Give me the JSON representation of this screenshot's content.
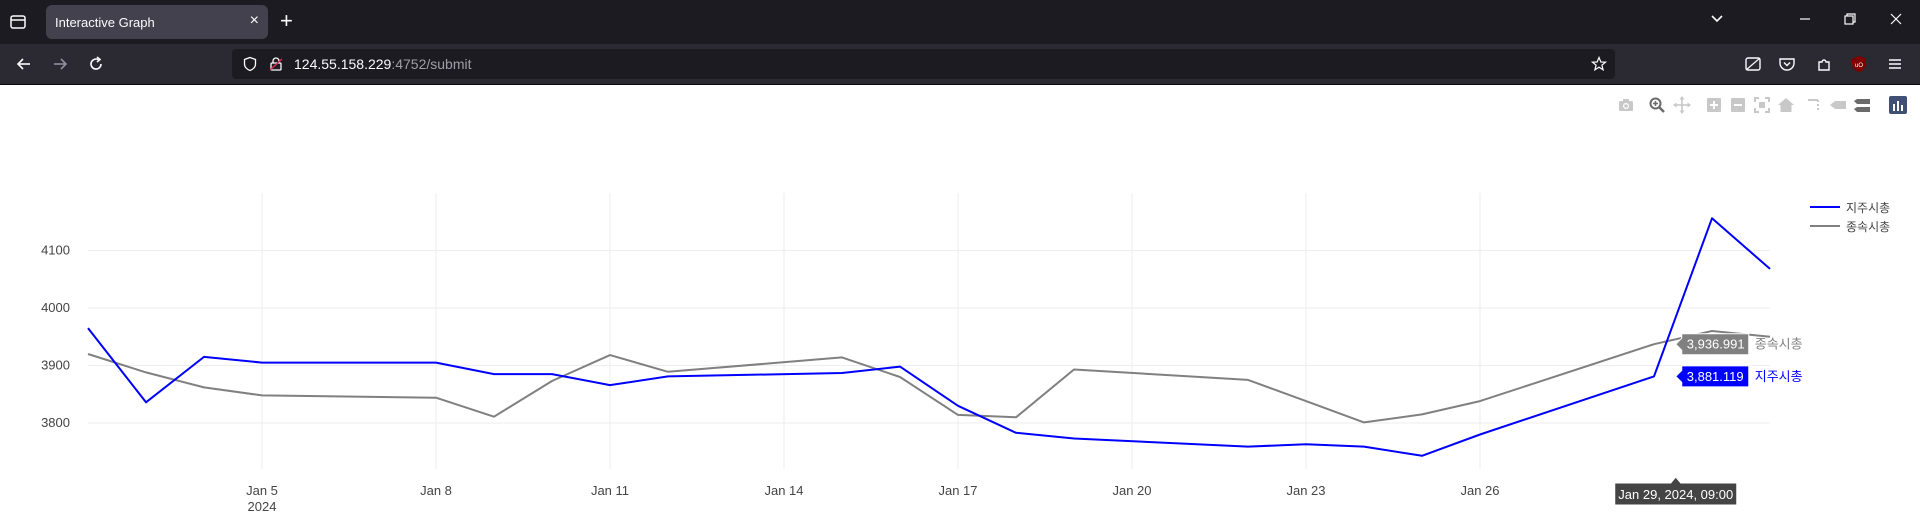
{
  "browser": {
    "tab_title": "Interactive Graph",
    "url_host": "124.55.158.229",
    "url_path": ":4752/submit",
    "tab_close": "×",
    "new_tab": "+"
  },
  "chart_data": {
    "type": "line",
    "title": "",
    "xlabel": "",
    "ylabel": "",
    "x": [
      "2024-01-02",
      "2024-01-03",
      "2024-01-04",
      "2024-01-05",
      "2024-01-08",
      "2024-01-09",
      "2024-01-10",
      "2024-01-11",
      "2024-01-12",
      "2024-01-15",
      "2024-01-16",
      "2024-01-17",
      "2024-01-18",
      "2024-01-19",
      "2024-01-22",
      "2024-01-23",
      "2024-01-24",
      "2024-01-25",
      "2024-01-26",
      "2024-01-29",
      "2024-01-30",
      "2024-01-31"
    ],
    "series": [
      {
        "name": "지주시총",
        "color": "#0000ff",
        "values": [
          3965,
          3836,
          3915,
          3905,
          3905,
          3885,
          3885,
          3866,
          3881,
          3887,
          3898,
          3830,
          3783,
          3773,
          3759,
          3763,
          3759,
          3743,
          3780,
          3881.119,
          4156,
          4068
        ]
      },
      {
        "name": "종속시총",
        "color": "#808080",
        "values": [
          3920,
          3888,
          3862,
          3848,
          3844,
          3811,
          3873,
          3918,
          3889,
          3914,
          3880,
          3814,
          3810,
          3893,
          3875,
          3838,
          3801,
          3815,
          3838,
          3936.991,
          3960,
          3950
        ]
      }
    ],
    "x_ticks": [
      {
        "date": "2024-01-05",
        "label": "Jan 5",
        "sublabel": "2024"
      },
      {
        "date": "2024-01-08",
        "label": "Jan 8"
      },
      {
        "date": "2024-01-11",
        "label": "Jan 11"
      },
      {
        "date": "2024-01-14",
        "label": "Jan 14"
      },
      {
        "date": "2024-01-17",
        "label": "Jan 17"
      },
      {
        "date": "2024-01-20",
        "label": "Jan 20"
      },
      {
        "date": "2024-01-23",
        "label": "Jan 23"
      },
      {
        "date": "2024-01-26",
        "label": "Jan 26"
      }
    ],
    "y_ticks": [
      3800,
      3900,
      4000,
      4100
    ],
    "xlim": [
      "2024-01-02",
      "2024-01-31"
    ],
    "ylim": [
      3720,
      4200
    ],
    "grid": true,
    "legend_placement": "top-right",
    "hover": {
      "x_label": "Jan 29, 2024, 09:00",
      "values": [
        {
          "series": "종속시총",
          "text": "3,936.991",
          "color": "#808080"
        },
        {
          "series": "지주시총",
          "text": "3,881.119",
          "color": "#0000ff"
        }
      ]
    }
  },
  "modebar": {
    "icons": [
      "camera-icon",
      "zoom-icon",
      "pan-icon",
      "zoom-in-icon",
      "zoom-out-icon",
      "autoscale-icon",
      "reset-axes-icon",
      "spike-lines-icon",
      "hover-closest-icon",
      "hover-compare-icon",
      "plotly-logo-icon"
    ]
  }
}
